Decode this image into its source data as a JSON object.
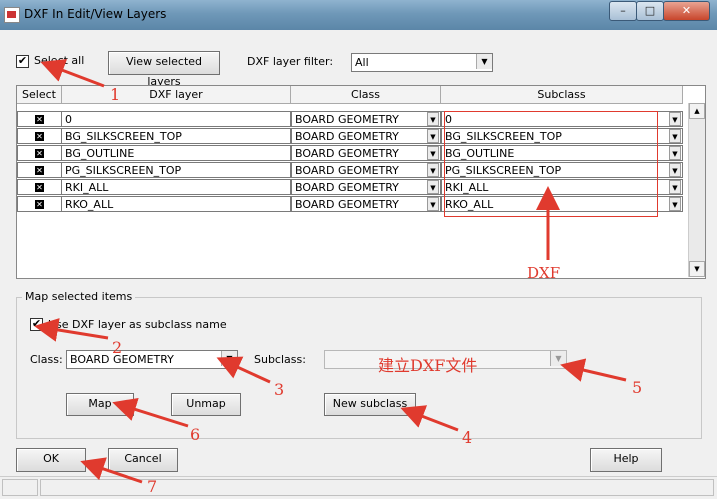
{
  "window": {
    "title": "DXF In Edit/View Layers"
  },
  "controls": {
    "select_all_label": "Select all",
    "view_selected_label": "View selected layers",
    "filter_label": "DXF layer filter:",
    "filter_value": "All"
  },
  "table": {
    "headers": [
      "Select",
      "DXF layer",
      "Class",
      "Subclass"
    ],
    "rows": [
      {
        "layer": "0",
        "class": "BOARD GEOMETRY",
        "subclass": "0"
      },
      {
        "layer": "BG_SILKSCREEN_TOP",
        "class": "BOARD GEOMETRY",
        "subclass": "BG_SILKSCREEN_TOP"
      },
      {
        "layer": "BG_OUTLINE",
        "class": "BOARD GEOMETRY",
        "subclass": "BG_OUTLINE"
      },
      {
        "layer": "PG_SILKSCREEN_TOP",
        "class": "BOARD GEOMETRY",
        "subclass": "PG_SILKSCREEN_TOP"
      },
      {
        "layer": "RKI_ALL",
        "class": "BOARD GEOMETRY",
        "subclass": "RKI_ALL"
      },
      {
        "layer": "RKO_ALL",
        "class": "BOARD GEOMETRY",
        "subclass": "RKO_ALL"
      }
    ]
  },
  "map_group": {
    "title": "Map selected items",
    "use_dxf_label": "Use DXF layer as subclass name",
    "class_label": "Class:",
    "class_value": "BOARD GEOMETRY",
    "subclass_label": "Subclass:",
    "map_button": "Map",
    "unmap_button": "Unmap",
    "new_subclass_button": "New subclass"
  },
  "footer": {
    "ok_button": "OK",
    "cancel_button": "Cancel",
    "help_button": "Help"
  },
  "annotations": {
    "n1": "1",
    "n2": "2",
    "n3": "3",
    "n4": "4",
    "n5": "5",
    "n6": "6",
    "n7": "7",
    "dxf": "DXF",
    "create_dxf": "建立DXF文件",
    "color": "#e03a2e"
  }
}
